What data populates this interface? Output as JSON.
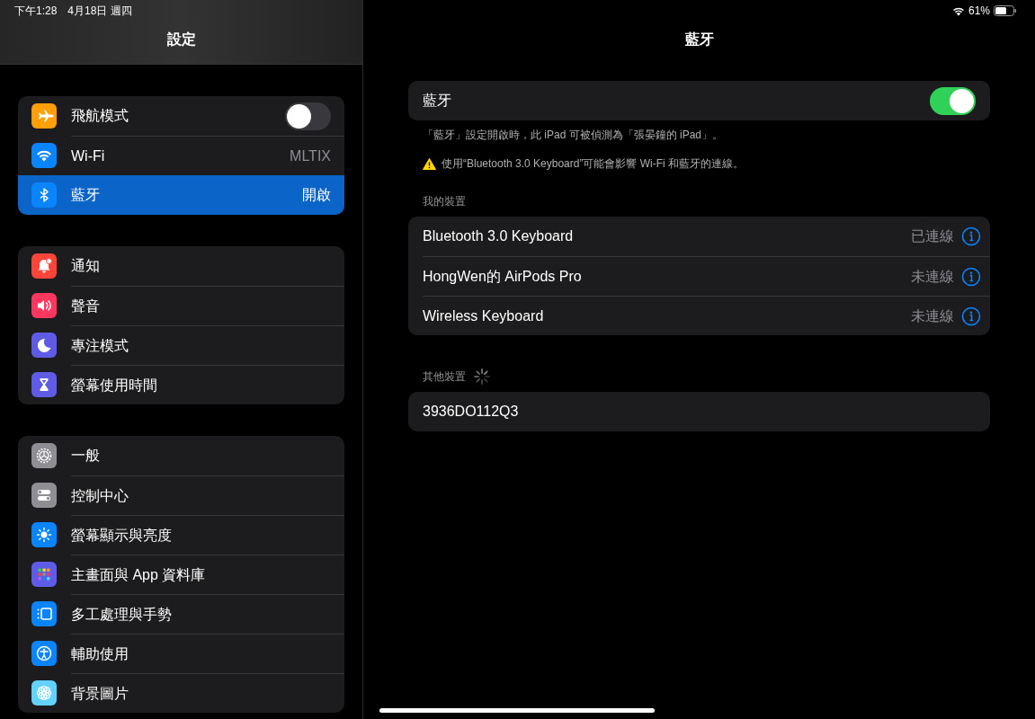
{
  "status_bar": {
    "time": "下午1:28",
    "date": "4月18日 週四",
    "battery": "61%"
  },
  "sidebar": {
    "title": "設定",
    "groups": [
      {
        "items": [
          {
            "label": "飛航模式",
            "kind": "toggle",
            "on": false,
            "selected": false
          },
          {
            "label": "Wi-Fi",
            "kind": "value",
            "value": "MLTIX",
            "selected": false
          },
          {
            "label": "藍牙",
            "kind": "value",
            "value": "開啟",
            "selected": true
          }
        ]
      },
      {
        "items": [
          {
            "label": "通知",
            "kind": "link",
            "selected": false
          },
          {
            "label": "聲音",
            "kind": "link",
            "selected": false
          },
          {
            "label": "專注模式",
            "kind": "link",
            "selected": false
          },
          {
            "label": "螢幕使用時間",
            "kind": "link",
            "selected": false
          }
        ]
      },
      {
        "items": [
          {
            "label": "一般",
            "kind": "link",
            "selected": false
          },
          {
            "label": "控制中心",
            "kind": "link",
            "selected": false
          },
          {
            "label": "螢幕顯示與亮度",
            "kind": "link",
            "selected": false
          },
          {
            "label": "主畫面與 App 資料庫",
            "kind": "link",
            "selected": false
          },
          {
            "label": "多工處理與手勢",
            "kind": "link",
            "selected": false
          },
          {
            "label": "輔助使用",
            "kind": "link",
            "selected": false
          },
          {
            "label": "背景圖片",
            "kind": "link",
            "selected": false
          }
        ]
      }
    ]
  },
  "detail": {
    "title": "藍牙",
    "toggle": {
      "label": "藍牙",
      "on": true
    },
    "notes": [
      "「藍牙」設定開啟時，此 iPad 可被偵測為「張晏鐘的 iPad」。",
      "使用“Bluetooth 3.0 Keyboard”可能會影響 Wi-Fi 和藍牙的連線。"
    ],
    "my_devices": {
      "header": "我的裝置",
      "devices": [
        {
          "name": "Bluetooth 3.0 Keyboard",
          "status": "已連線"
        },
        {
          "name": "HongWen的 AirPods Pro",
          "status": "未連線"
        },
        {
          "name": "Wireless Keyboard",
          "status": "未連線"
        }
      ]
    },
    "other_devices": {
      "header": "其他裝置",
      "searching": true,
      "devices": [
        {
          "name": "3936DO112Q3"
        }
      ]
    }
  }
}
